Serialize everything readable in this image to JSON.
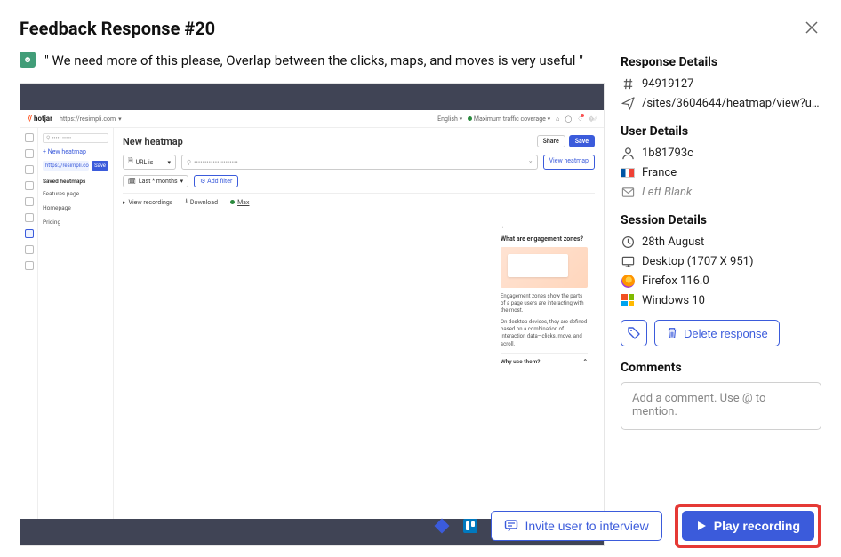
{
  "header": {
    "title": "Feedback Response #20"
  },
  "quote": "\" We need more of this please, Overlap between the clicks, maps, and moves is very useful \"",
  "response_details": {
    "title": "Response Details",
    "id": "94919127",
    "path": "/sites/3604644/heatmap/view?u…"
  },
  "user_details": {
    "title": "User Details",
    "user_id": "1b81793c",
    "country": "France",
    "email": "Left Blank"
  },
  "session_details": {
    "title": "Session Details",
    "date": "28th August",
    "viewport": "Desktop (1707 X 951)",
    "browser": "Firefox 116.0",
    "os": "Windows 10"
  },
  "actions": {
    "delete": "Delete response"
  },
  "comments": {
    "title": "Comments",
    "placeholder": "Add a comment. Use @ to mention."
  },
  "footer": {
    "invite": "Invite user to interview",
    "play": "Play recording"
  },
  "screenshot": {
    "brand": "hotjar",
    "domain": "https://resimpli.com",
    "top_right": {
      "lang": "English",
      "coverage": "Maximum traffic coverage"
    },
    "sidebar": {
      "search_placeholder": "",
      "new_heatmap": "+  New heatmap",
      "current_url": "https://resimpli.com/f…",
      "save": "Save",
      "saved_header": "Saved heatmaps",
      "items": [
        "Features page",
        "Homepage",
        "Pricing"
      ]
    },
    "main": {
      "title": "New heatmap",
      "share": "Share",
      "save": "Save",
      "url_is": "URL is",
      "url_input_placeholder": "",
      "view_heatmap": "View heatmap",
      "date_filter": "Last * months",
      "add_filter": "Add filter",
      "tabs": {
        "recordings": "View recordings",
        "download": "Download",
        "max": "Max"
      },
      "panel": {
        "heading": "What are engagement zones?",
        "p1": "Engagement zones show the parts of a page users are interacting with the most.",
        "p2": "On desktop devices, they are defined based on a combination of interaction data—clicks, move, and scroll.",
        "why": "Why use them?"
      }
    }
  }
}
